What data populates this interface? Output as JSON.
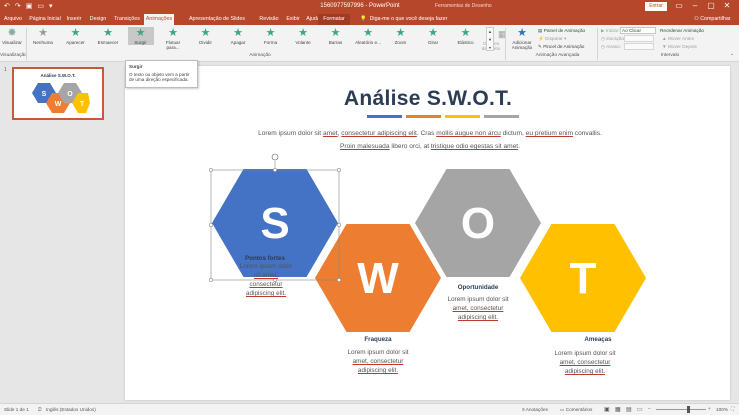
{
  "window": {
    "title": "1560977597996 - PowerPoint",
    "tools_label": "Ferramentas de Desenho",
    "signin": "Entrar",
    "share": "Compartilhar"
  },
  "tabs": [
    "Arquivo",
    "Página Inicial",
    "Inserir",
    "Design",
    "Transições",
    "Animações",
    "Apresentação de Slides",
    "Revisão",
    "Exibir",
    "Ajuda",
    "Formatar"
  ],
  "active_tab": "Animações",
  "tellme": "Diga-me o que você deseja fazer",
  "ribbon": {
    "preview": {
      "label": "Visualizar",
      "group": "Visualização"
    },
    "effects": [
      "Nenhuma",
      "Aparecer",
      "Esmaecer",
      "Surgir",
      "Flutuar para...",
      "Dividir",
      "Apagar",
      "Forma",
      "Volante",
      "Barras",
      "Aleatório e...",
      "Zoom",
      "Girar",
      "Elástico"
    ],
    "effect_options": "Opções de Efeito",
    "animation_group": "Animação",
    "add_animation": "Adicionar Animação",
    "advanced": [
      "Painel de Animação",
      "Disparar",
      "Pincel de Animação"
    ],
    "advanced_group": "Animação Avançada",
    "timing": {
      "start_label": "Iniciar:",
      "start_value": "Ao Clicar",
      "duration_label": "Duração:",
      "delay_label": "Atraso:"
    },
    "reorder": [
      "Reordenar Animação",
      "Mover Antes",
      "Mover Depois"
    ],
    "timing_group": "Intervalo"
  },
  "tooltip": {
    "title": "Surgir",
    "text": "O texto ou objeto vem a partir de uma direção especificada."
  },
  "thumbnail": {
    "number": "1",
    "title": "Análise S.W.O.T."
  },
  "slide": {
    "title": "Análise S.W.O.T.",
    "bar_colors": [
      "#4472c4",
      "#ed7d31",
      "#ffc000",
      "#a5a5a5"
    ],
    "intro": [
      "Lorem ipsum dolor sit ",
      "amet",
      ", ",
      "consectetur adipiscing elit",
      ". Cras ",
      "mollis augue non arcu",
      " dictum, ",
      "eu pretium enim",
      " convallis. ",
      "Proin malesuada",
      " libero orci, at ",
      "tristique odio egestas sit amet",
      "."
    ],
    "hexes": [
      {
        "letter": "S",
        "color": "#4472c4",
        "caption": "Pontos fortes",
        "body": [
          "Lorem ipsum dolor",
          "sit amet,",
          "consectetur",
          "adipiscing elit."
        ]
      },
      {
        "letter": "W",
        "color": "#ed7d31",
        "caption": "Fraqueza",
        "body": [
          "Lorem ipsum dolor sit",
          "amet, consectetur",
          "adipiscing elit."
        ]
      },
      {
        "letter": "O",
        "color": "#a5a5a5",
        "caption": "Oportunidade",
        "body": [
          "Lorem ipsum dolor sit",
          "amet, consectetur",
          "adipiscing elit."
        ]
      },
      {
        "letter": "T",
        "color": "#ffc000",
        "caption": "Ameaças",
        "body": [
          "Lorem ipsum dolor sit",
          "amet, consectetur",
          "adipiscing elit."
        ]
      }
    ]
  },
  "status": {
    "slide": "Slide 1 de 1",
    "lang": "Inglês (Estados Unidos)",
    "notes": "Anotações",
    "comments": "Comentários",
    "zoom": "100%"
  }
}
